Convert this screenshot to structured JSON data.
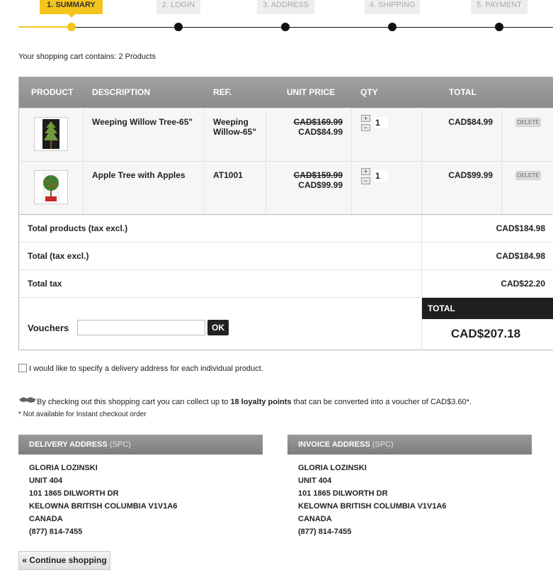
{
  "steps": [
    {
      "label": "1. SUMMARY",
      "active": true
    },
    {
      "label": "2. LOGIN",
      "active": false
    },
    {
      "label": "3. ADDRESS",
      "active": false
    },
    {
      "label": "4. SHIPPING",
      "active": false
    },
    {
      "label": "5. PAYMENT",
      "active": false
    }
  ],
  "cart_summary": "Your shopping cart contains: 2 Products",
  "table": {
    "headers": {
      "product": "PRODUCT",
      "description": "DESCRIPTION",
      "ref": "REF.",
      "unit_price": "UNIT PRICE",
      "qty": "QTY",
      "total": "TOTAL"
    },
    "rows": [
      {
        "description": "Weeping Willow Tree-65\"",
        "ref": "Weeping Willow-65\"",
        "old_price": "CAD$169.99",
        "price": "CAD$84.99",
        "qty": "1",
        "total": "CAD$84.99",
        "delete": "DELETE"
      },
      {
        "description": "Apple Tree with Apples",
        "ref": "AT1001",
        "old_price": "CAD$159.99",
        "price": "CAD$99.99",
        "qty": "1",
        "total": "CAD$99.99",
        "delete": "DELETE"
      }
    ]
  },
  "totals": {
    "products_label": "Total products (tax excl.)",
    "products_value": "CAD$184.98",
    "tax_excl_label": "Total (tax excl.)",
    "tax_excl_value": "CAD$184.98",
    "tax_label": "Total tax",
    "tax_value": "CAD$22.20",
    "grand_label": "TOTAL",
    "grand_value": "CAD$207.18"
  },
  "voucher": {
    "label": "Vouchers",
    "button": "OK",
    "value": ""
  },
  "multi_address": "I would like to specify a delivery address for each individual product.",
  "loyalty": {
    "prefix": "By checking out this shopping cart you can collect up to",
    "points": "18 loyalty points",
    "suffix": "that can be converted into a voucher of CAD$3.60*.",
    "note": "* Not available for Instant checkout order"
  },
  "delivery": {
    "title": "DELIVERY ADDRESS",
    "tag": "(SPC)",
    "lines": [
      "GLORIA LOZINSKI",
      "UNIT 404",
      "101 1865 DILWORTH DR",
      "KELOWNA BRITISH COLUMBIA V1V1A6",
      "CANADA",
      "(877) 814-7455"
    ]
  },
  "invoice": {
    "title": "INVOICE ADDRESS",
    "tag": "(SPC)",
    "lines": [
      "GLORIA LOZINSKI",
      "UNIT 404",
      "101 1865 DILWORTH DR",
      "KELOWNA BRITISH COLUMBIA V1V1A6",
      "CANADA",
      "(877) 814-7455"
    ]
  },
  "continue_label": "« Continue shopping",
  "colors": {
    "accent": "#f5c51f",
    "header_gray": "#999999",
    "dark": "#1f1f1f"
  }
}
